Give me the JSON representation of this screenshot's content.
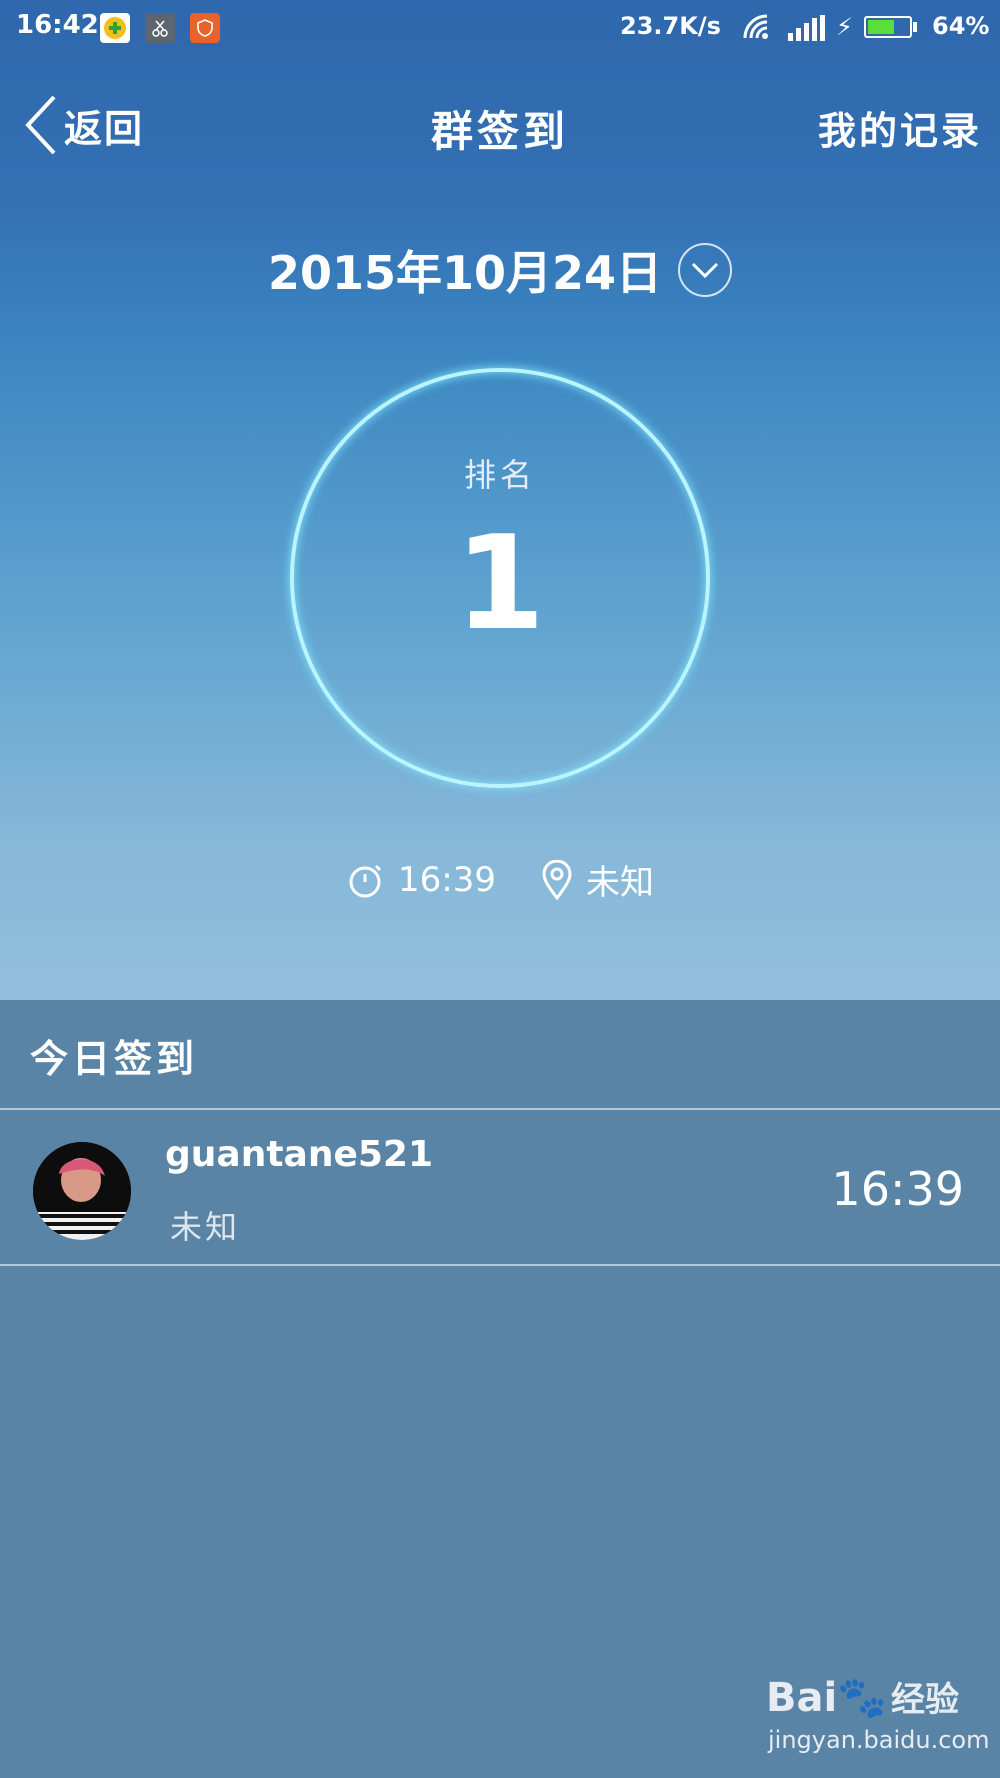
{
  "status_bar": {
    "time": "16:42",
    "net_speed": "23.7K/s",
    "battery_pct": "64%",
    "battery_level": 0.64,
    "battery_color": "#5adf3a"
  },
  "nav": {
    "back_label": "返回",
    "title": "群签到",
    "records_label": "我的记录"
  },
  "date": "2015年10月24日",
  "rank_card": {
    "label": "排名",
    "rank": "1",
    "ring_color": "#b9f4ff"
  },
  "meta": {
    "time": "16:39",
    "location": "未知"
  },
  "today_list": {
    "header": "今日签到",
    "items": [
      {
        "name": "guantane521",
        "location": "未知",
        "time": "16:39"
      }
    ]
  },
  "watermark": {
    "brand": "Bai",
    "brand_cn": "经验",
    "domain": "jingyan.baidu.com"
  }
}
